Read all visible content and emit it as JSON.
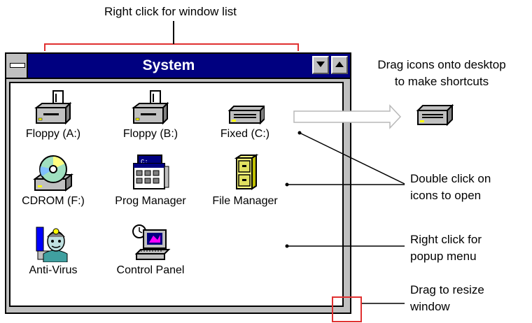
{
  "annotations": {
    "window_list": "Right click for window list",
    "drag_line1": "Drag icons onto desktop",
    "drag_line2": "to make shortcuts",
    "dbl_line1": "Double click on",
    "dbl_line2": "icons to open",
    "popup_line1": "Right click for",
    "popup_line2": "popup menu",
    "resize_line1": "Drag to resize",
    "resize_line2": "window"
  },
  "window": {
    "title": "System",
    "icons": [
      {
        "label": "Floppy (A:)",
        "icon": "floppy-drive-icon"
      },
      {
        "label": "Floppy (B:)",
        "icon": "floppy-drive-icon"
      },
      {
        "label": "Fixed (C:)",
        "icon": "hard-drive-icon"
      },
      {
        "label": "CDROM (F:)",
        "icon": "cdrom-drive-icon"
      },
      {
        "label": "Prog Manager",
        "icon": "program-manager-icon"
      },
      {
        "label": "File Manager",
        "icon": "file-cabinet-icon"
      },
      {
        "label": "Anti-Virus",
        "icon": "anti-virus-doctor-icon"
      },
      {
        "label": "Control Panel",
        "icon": "control-panel-icon"
      }
    ]
  },
  "colors": {
    "title_bar": "#000080",
    "callout_red": "#e03030",
    "drive_yellow": "#ffff00"
  }
}
